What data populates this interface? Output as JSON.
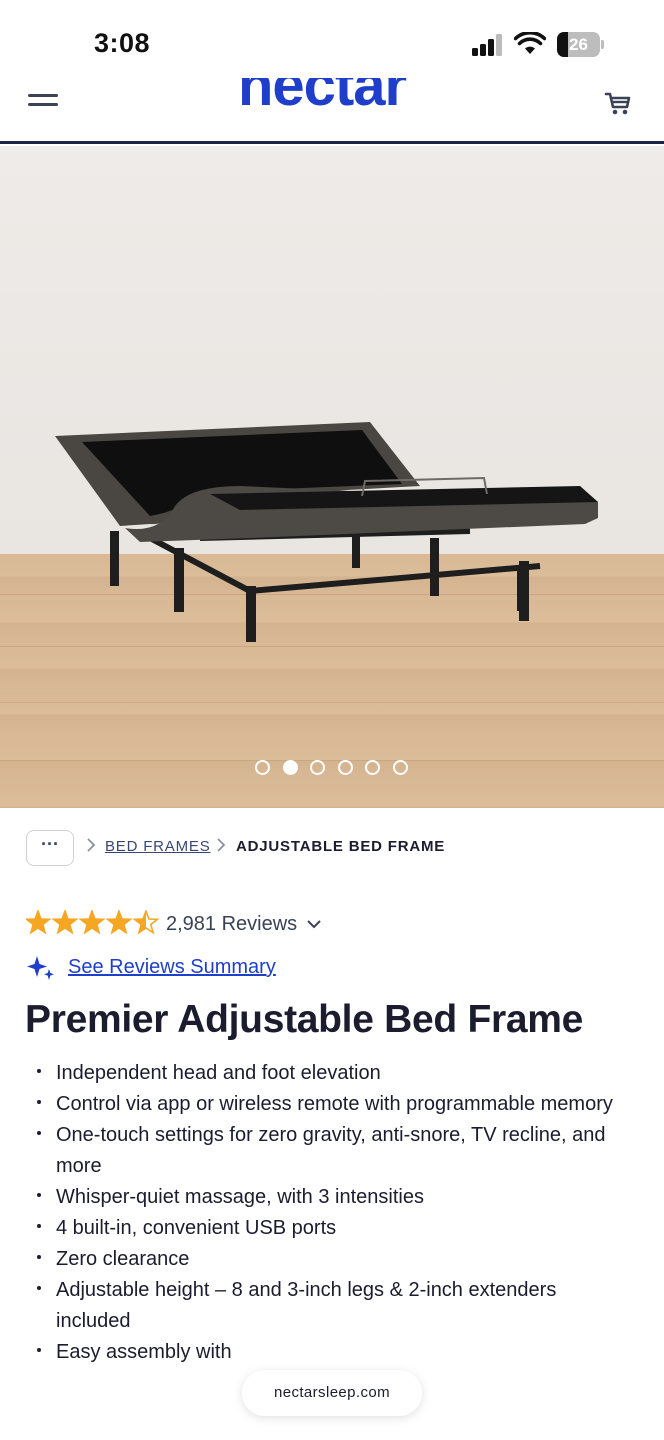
{
  "status_bar": {
    "time": "3:08",
    "battery": "26",
    "battery_level": 0.26
  },
  "header": {
    "logo": "nectar",
    "menu_icon": "hamburger-icon",
    "cart_icon": "cart-icon"
  },
  "hero": {
    "image_alt": "adjustable-bed-frame-photo",
    "carousel": {
      "count": 6,
      "active_index": 1
    }
  },
  "breadcrumb": {
    "more_label": "···",
    "items": [
      {
        "label": "BED FRAMES",
        "link": true
      },
      {
        "label": "ADJUSTABLE BED FRAME",
        "link": false
      }
    ]
  },
  "rating": {
    "stars": 4.5,
    "reviews_label": "2,981 Reviews",
    "star_color": "#f5a623"
  },
  "summary_link": "See Reviews Summary",
  "product": {
    "title": "Premier Adjustable Bed Frame",
    "features": [
      "Independent head and foot elevation",
      "Control via app or wireless remote with programmable memory",
      "One-touch settings for zero gravity, anti-snore, TV recline, and more",
      "Whisper-quiet massage, with 3 intensities",
      "4 built-in, convenient USB ports",
      "Zero clearance",
      "Adjustable height – 8 and 3-inch legs & 2-inch extenders included",
      "Easy assembly with"
    ]
  },
  "browser": {
    "url": "nectarsleep.com"
  },
  "colors": {
    "brand_blue": "#1f3ec9",
    "header_rule": "#1b2347",
    "text": "#1b1c2e"
  }
}
